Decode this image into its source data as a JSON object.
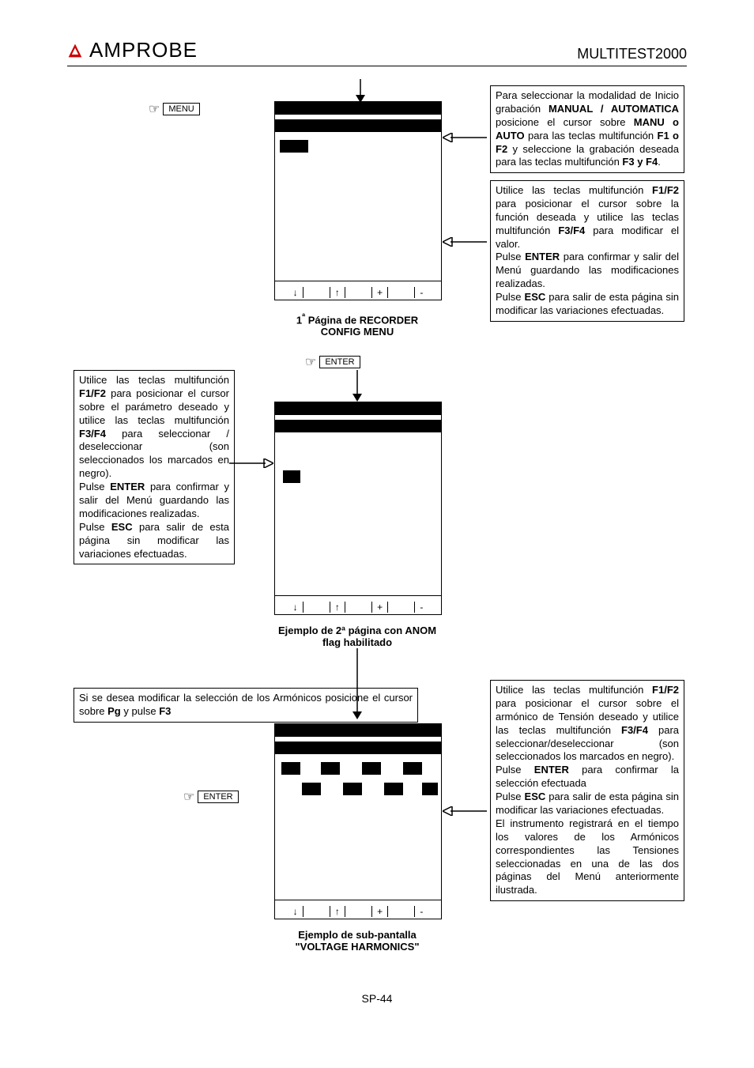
{
  "header": {
    "brand": "AMPROBE",
    "model": "MULTITEST2000"
  },
  "keylabels": {
    "menu": "MENU",
    "enter1": "ENTER",
    "enter2": "ENTER"
  },
  "softkeys": {
    "k1": "↓",
    "k2": "↑",
    "k3": "+",
    "k4": "-"
  },
  "captions": {
    "screen1_pre": "1",
    "screen1_sup": "ª",
    "screen1_line1": " Página de RECORDER",
    "screen1_line2": "CONFIG MENU",
    "screen2_line1": "Ejemplo de 2ª página con ANOM",
    "screen2_line2": "flag habilitado",
    "screen3_line1": "Ejemplo de sub-pantalla",
    "screen3_line2": "\"VOLTAGE HARMONICS\""
  },
  "box_top_right": {
    "t1": "Para seleccionar la modalidad de Inicio grabación ",
    "b1": "MANUAL / AUTOMATICA",
    "t2": " posicione el cursor sobre ",
    "b2": "MANU o AUTO",
    "t3": " para las teclas multifunción ",
    "b3": "F1 o F2",
    "t4": " y seleccione la grabación deseada para las teclas multifunción ",
    "b4": "F3 y F4",
    "t5": "."
  },
  "box_mid_right": {
    "t1": "Utilice las teclas multifunción ",
    "b1": "F1/F2",
    "t2": " para posicionar el cursor sobre la función deseada y utilice las teclas multifunción ",
    "b2": "F3/F4",
    "t3": " para modificar el valor.",
    "t4": "Pulse ",
    "b3": "ENTER",
    "t5": " para confirmar y salir del Menú guardando las modificaciones realizadas.",
    "t6": "Pulse ",
    "b4": "ESC",
    "t7": " para salir  de esta página sin modificar las variaciones efectuadas."
  },
  "box_left": {
    "t1": "Utilice las teclas multifunción ",
    "b1": "F1/F2",
    "t2": " para posicionar el cursor sobre el parámetro deseado y utilice las teclas multifunción ",
    "b2": "F3/F4",
    "t3": " para seleccionar / deseleccionar (son seleccionados los marcados en negro).",
    "t4": "Pulse ",
    "b3": "ENTER",
    "t5": " para confirmar y salir del  Menú guardando las modificaciones realizadas.",
    "t6": "Pulse ",
    "b4": "ESC",
    "t7": " para salir  de esta página sin modificar las variaciones efectuadas."
  },
  "box_center": {
    "t1": "Si se desea modificar la selección de los Armónicos posicione el cursor sobre ",
    "b1": "Pg",
    "t2": " y pulse ",
    "b2": "F3"
  },
  "box_bottom_right": {
    "t1": "Utilice las teclas multifunción ",
    "b1": "F1/F2",
    "t2": " para posicionar el cursor sobre el armónico de Tensión deseado y utilice las teclas multifunción ",
    "b2": "F3/F4",
    "t3": " para seleccionar/deseleccionar (son seleccionados los marcados en negro).",
    "t4": "Pulse ",
    "b3": "ENTER",
    "t5": " para confirmar la selección efectuada",
    "t6": "Pulse ",
    "b4": "ESC",
    "t7": " para salir  de esta página sin modificar las variaciones efectuadas.",
    "t8": "El instrumento registrará en el tiempo los valores de los Armónicos correspondientes las Tensiones seleccionadas en una de las dos páginas del Menú anteriormente ilustrada."
  },
  "page_number": "SP-44"
}
